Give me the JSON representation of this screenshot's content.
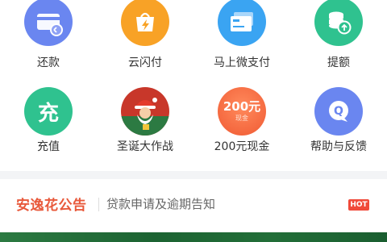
{
  "grid": {
    "items": [
      {
        "label": "还款",
        "icon": "card-return-icon",
        "color": "#6a86f0"
      },
      {
        "label": "云闪付",
        "icon": "lightning-bag-icon",
        "color": "#f8a226"
      },
      {
        "label": "马上微支付",
        "icon": "cards-icon",
        "color": "#3aa4f2"
      },
      {
        "label": "提额",
        "icon": "coin-stack-up-icon",
        "color": "#2fc28f"
      },
      {
        "label": "充值",
        "icon": "recharge-icon",
        "color": "#2fc28f"
      },
      {
        "label": "圣诞大作战",
        "icon": "santa-icon",
        "color": "#c8372a"
      },
      {
        "label": "200元现金",
        "icon": "cash-200-icon",
        "color": "#f05a33"
      },
      {
        "label": "帮助与反馈",
        "icon": "help-q-icon",
        "color": "#6a86f0"
      }
    ],
    "recharge_glyph": "充",
    "cash_amount": "200元",
    "cash_sub": "现金"
  },
  "notice": {
    "brand": "安逸花公告",
    "text": "贷款申请及逾期告知",
    "badge": "HOT"
  }
}
